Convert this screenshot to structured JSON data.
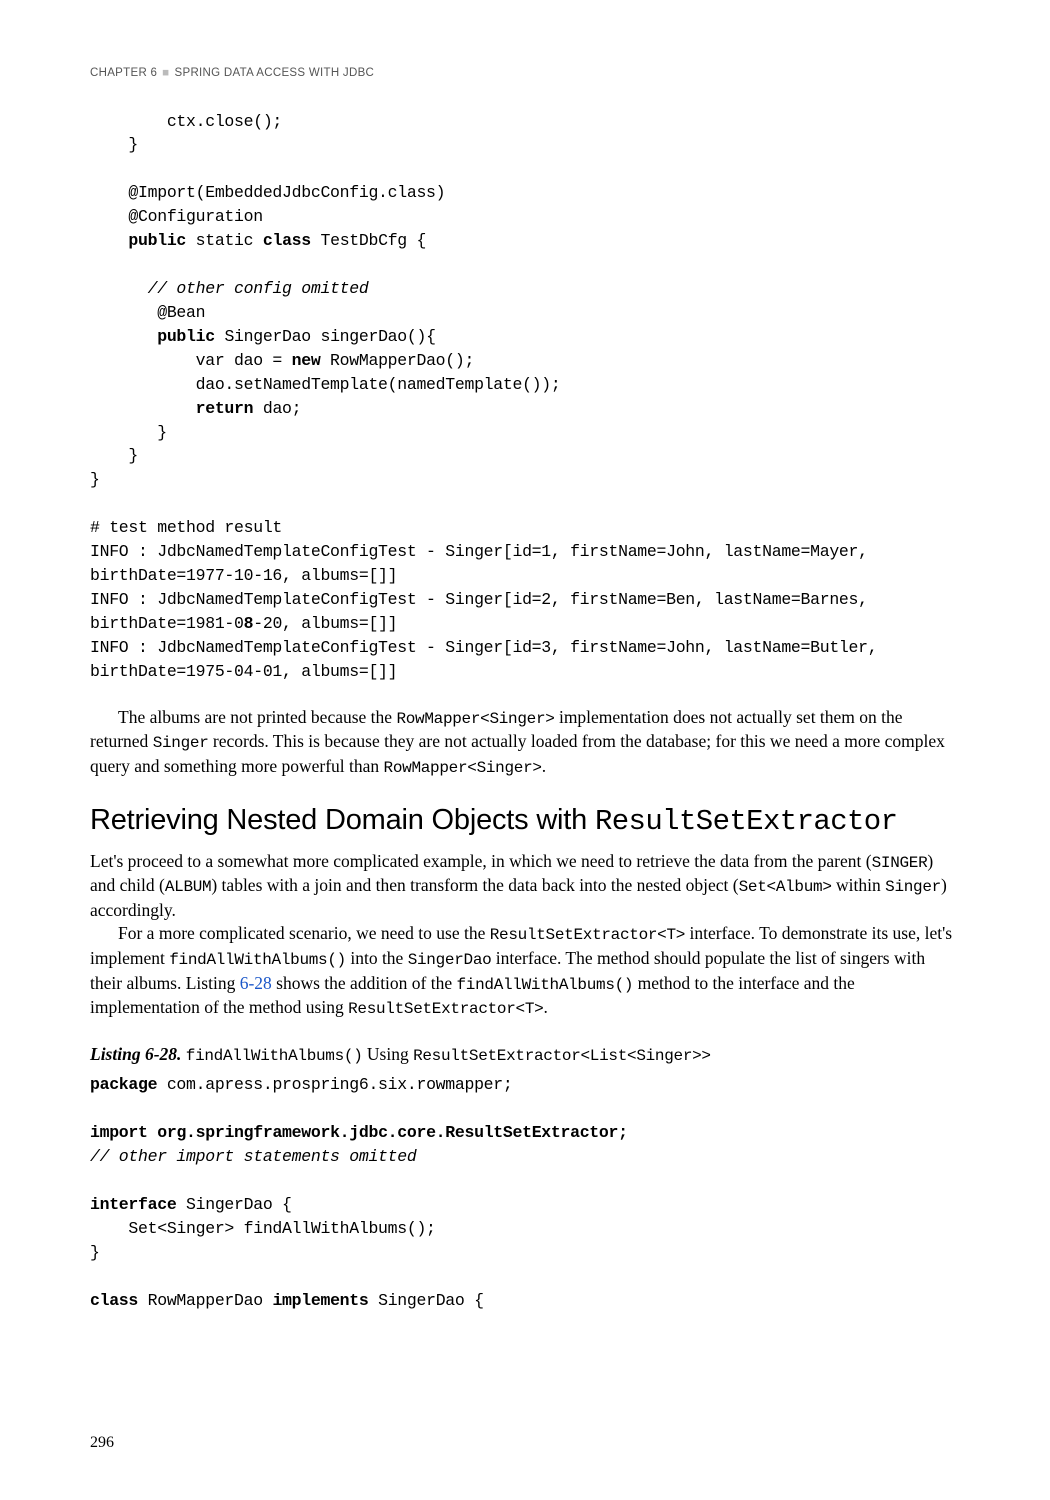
{
  "header": {
    "chapter": "CHAPTER 6",
    "title": "SPRING DATA ACCESS WITH JDBC"
  },
  "code1": {
    "l1": "        ctx.close();",
    "l2": "    }",
    "l3": "",
    "l4": "    @Import(EmbeddedJdbcConfig.class)",
    "l5": "    @Configuration",
    "l6a": "    ",
    "l6b": "public",
    "l6c": " static ",
    "l6d": "class",
    "l6e": " TestDbCfg {",
    "l7": "",
    "l8a": "      ",
    "l8b": "// other config omitted",
    "l9": "       @Bean",
    "l10a": "       ",
    "l10b": "public",
    "l10c": " SingerDao singerDao(){",
    "l11a": "           var dao = ",
    "l11b": "new",
    "l11c": " RowMapperDao();",
    "l12": "           dao.setNamedTemplate(namedTemplate());",
    "l13a": "           ",
    "l13b": "return",
    "l13c": " dao;",
    "l14": "       }",
    "l15": "    }",
    "l16": "}",
    "l17": "",
    "l18": "# test method result",
    "l19": "INFO : JdbcNamedTemplateConfigTest - Singer[id=1, firstName=John, lastName=Mayer,",
    "l20": "birthDate=1977-10-16, albums=[]]",
    "l21": "INFO : JdbcNamedTemplateConfigTest - Singer[id=2, firstName=Ben, lastName=Barnes,",
    "l22a": "birthDate=1981-0",
    "l22b": "8",
    "l22c": "-20, albums=[]]",
    "l23": "INFO : JdbcNamedTemplateConfigTest - Singer[id=3, firstName=John, lastName=Butler,",
    "l24": "birthDate=1975-04-01, albums=[]]"
  },
  "para1": {
    "t1": "The albums are not printed because the ",
    "m1": "RowMapper<Singer>",
    "t2": " implementation does not actually set them on the returned ",
    "m2": "Singer",
    "t3": " records. This is because they are not actually loaded from the database; for this we need a more complex query and something more powerful than ",
    "m3": "RowMapper<Singer>",
    "t4": "."
  },
  "section_heading": {
    "text": "Retrieving Nested Domain Objects with ",
    "code": "ResultSetExtractor"
  },
  "para2": {
    "t1": "Let's proceed to a somewhat more complicated example, in which we need to retrieve the data from the parent (",
    "m1": "SINGER",
    "t2": ") and child (",
    "m2": "ALBUM",
    "t3": ") tables with a join and then transform the data back into the nested object (",
    "m3": "Set<Album>",
    "t4": " within ",
    "m4": "Singer",
    "t5": ") accordingly."
  },
  "para3": {
    "t1": "For a more complicated scenario, we need to use the ",
    "m1": "ResultSetExtractor<T>",
    "t2": " interface. To demonstrate its use, let's implement ",
    "m2": "findAllWithAlbums()",
    "t3": " into the ",
    "m3": "SingerDao",
    "t4": " interface. The method should populate the list of singers with their albums. Listing ",
    "link": "6-28",
    "t5": " shows the addition of the ",
    "m4": "findAllWithAlbums()",
    "t6": " method to the interface and the implementation of the method using ",
    "m5": "ResultSetExtractor<T>",
    "t7": "."
  },
  "listing": {
    "label": "Listing 6-28.",
    "m1": "findAllWithAlbums()",
    "t1": " Using ",
    "m2": "ResultSetExtractor<List<Singer>>"
  },
  "code2": {
    "l1a": "package",
    "l1b": " com.apress.prospring6.six.rowmapper;",
    "l2": "",
    "l3a": "import",
    "l3b": " ",
    "l3c": "org.springframework.jdbc.core.ResultSetExtractor;",
    "l4": "// other import statements omitted",
    "l5": "",
    "l6a": "interface",
    "l6b": " SingerDao {",
    "l7": "    Set<Singer> findAllWithAlbums();",
    "l8": "}",
    "l9": "",
    "l10a": "class",
    "l10b": " RowMapperDao ",
    "l10c": "implements",
    "l10d": " SingerDao {"
  },
  "page_number": "296"
}
